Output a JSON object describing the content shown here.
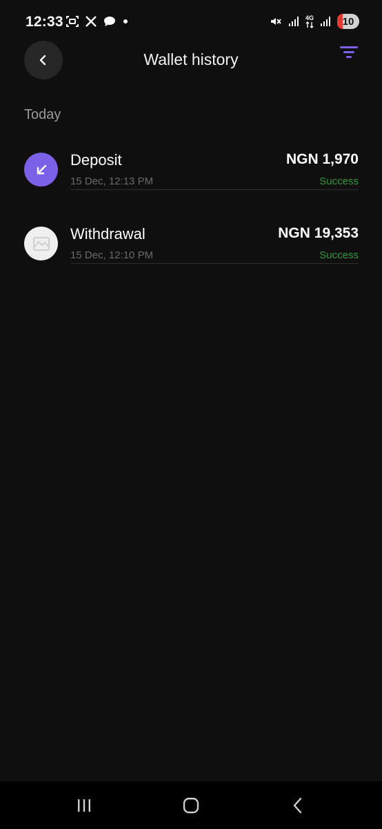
{
  "status_bar": {
    "time": "12:33",
    "network_label": "4G",
    "battery": "10"
  },
  "header": {
    "title": "Wallet history"
  },
  "section": {
    "label": "Today"
  },
  "transactions": [
    {
      "title": "Deposit",
      "date": "15 Dec, 12:13 PM",
      "amount": "NGN 1,970",
      "status": "Success",
      "icon": "arrow-down-left-icon"
    },
    {
      "title": "Withdrawal",
      "date": "15 Dec, 12:10 PM",
      "amount": "NGN 19,353",
      "status": "Success",
      "icon": "image-placeholder-icon"
    }
  ],
  "colors": {
    "background": "#0f0f0f",
    "accent": "#7b61e8",
    "success": "#2e9a3c",
    "muted_text": "#6a6a6a"
  }
}
